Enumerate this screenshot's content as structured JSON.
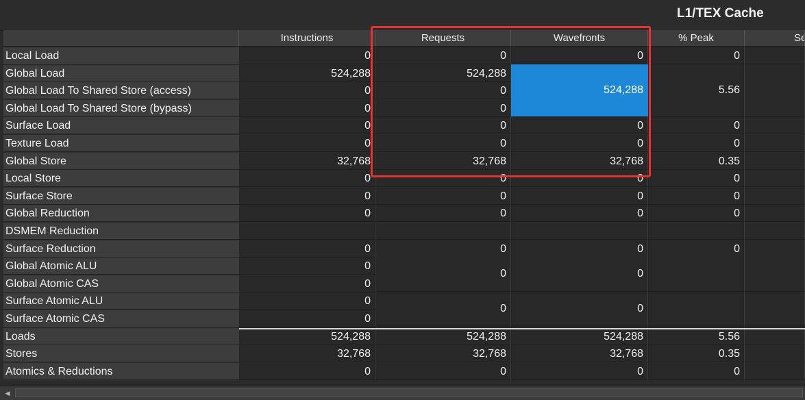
{
  "section_title": "L1/TEX Cache",
  "columns": [
    "Instructions",
    "Requests",
    "Wavefronts",
    "% Peak",
    "Se"
  ],
  "rows": [
    {
      "label": "Local Load",
      "instructions": "0",
      "requests": "0",
      "wavefronts": "0",
      "peak": "0"
    },
    {
      "label": "Global Load",
      "instructions": "524,288",
      "requests": "524,288",
      "wavefronts": "",
      "peak": ""
    },
    {
      "label": "Global Load To Shared Store (access)",
      "instructions": "0",
      "requests": "0",
      "wavefronts": "",
      "peak": ""
    },
    {
      "label": "Global Load To Shared Store (bypass)",
      "instructions": "0",
      "requests": "0",
      "wavefronts": "",
      "peak": ""
    },
    {
      "label": "Surface Load",
      "instructions": "0",
      "requests": "0",
      "wavefronts": "0",
      "peak": "0"
    },
    {
      "label": "Texture Load",
      "instructions": "0",
      "requests": "0",
      "wavefronts": "0",
      "peak": "0"
    },
    {
      "label": "Global Store",
      "instructions": "32,768",
      "requests": "32,768",
      "wavefronts": "32,768",
      "peak": "0.35"
    },
    {
      "label": "Local Store",
      "instructions": "0",
      "requests": "0",
      "wavefronts": "0",
      "peak": "0"
    },
    {
      "label": "Surface Store",
      "instructions": "0",
      "requests": "0",
      "wavefronts": "0",
      "peak": "0"
    },
    {
      "label": "Global Reduction",
      "instructions": "0",
      "requests": "0",
      "wavefronts": "0",
      "peak": "0"
    },
    {
      "label": "DSMEM Reduction",
      "instructions": "",
      "requests": "",
      "wavefronts": "",
      "peak": ""
    },
    {
      "label": "Surface Reduction",
      "instructions": "0",
      "requests": "0",
      "wavefronts": "0",
      "peak": "0"
    },
    {
      "label": "Global Atomic ALU",
      "instructions": "0",
      "requests": "",
      "wavefronts": "",
      "peak": ""
    },
    {
      "label": "Global Atomic CAS",
      "instructions": "0",
      "requests": "",
      "wavefronts": "",
      "peak": ""
    },
    {
      "label": "Surface Atomic ALU",
      "instructions": "0",
      "requests": "",
      "wavefronts": "",
      "peak": ""
    },
    {
      "label": "Surface Atomic CAS",
      "instructions": "0",
      "requests": "",
      "wavefronts": "",
      "peak": ""
    },
    {
      "label": "Loads",
      "instructions": "524,288",
      "requests": "524,288",
      "wavefronts": "524,288",
      "peak": "5.56"
    },
    {
      "label": "Stores",
      "instructions": "32,768",
      "requests": "32,768",
      "wavefronts": "32,768",
      "peak": "0.35"
    },
    {
      "label": "Atomics & Reductions",
      "instructions": "0",
      "requests": "0",
      "wavefronts": "0",
      "peak": "0"
    }
  ],
  "merged": {
    "global_load_wavefronts": "524,288",
    "global_load_peak": "5.56",
    "global_atomic_requests": "0",
    "global_atomic_wavefronts": "0",
    "surface_atomic_requests": "0",
    "surface_atomic_wavefronts": "0"
  },
  "selected_color": "#1e88d8",
  "highlight_color": "#e83232",
  "scroll_left_icon": "◀"
}
